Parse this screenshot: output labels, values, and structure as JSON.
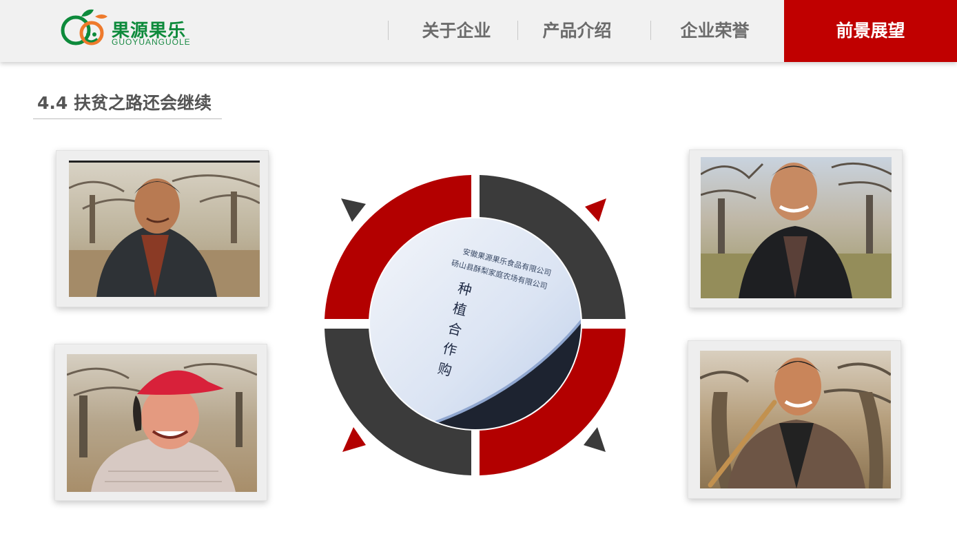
{
  "brand": {
    "name": "果源果乐",
    "subtitle": "GUOYUANGUOLE",
    "colors": {
      "green": "#0d8a3b",
      "red": "#c00000",
      "orange": "#ee7a2c"
    }
  },
  "nav": {
    "items": [
      {
        "label": "关于企业",
        "active": false
      },
      {
        "label": "产品介绍",
        "active": false
      },
      {
        "label": "企业荣誉",
        "active": false
      },
      {
        "label": "前景展望",
        "active": true
      }
    ]
  },
  "section": {
    "title": "4.4 扶贫之路还会继续"
  },
  "photos": [
    {
      "subject": "smiling elderly man in dark jacket, orchard background"
    },
    {
      "subject": "smiling woman in red cap and knit sweater, orchard background"
    },
    {
      "subject": "smiling man in black jacket, orchard background"
    },
    {
      "subject": "smiling man holding a wooden hoe, orchard background"
    }
  ],
  "center": {
    "company_line_1": "安徽果源果乐食品有限公司",
    "company_line_2": "砀山县酥梨家庭农场有限公司",
    "contract_chars": [
      "种",
      "植",
      "合",
      "作",
      "购"
    ],
    "ring_colors": {
      "red": "#b30000",
      "dark": "#3b3b3b"
    }
  }
}
